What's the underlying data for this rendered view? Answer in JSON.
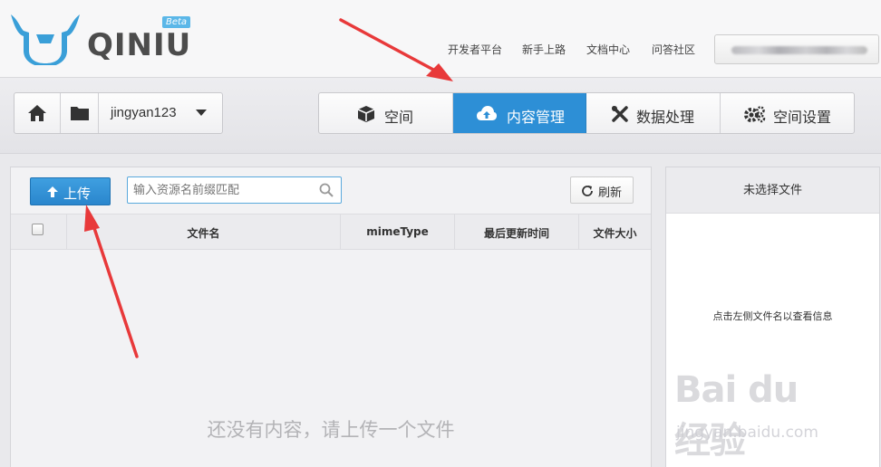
{
  "brand": {
    "name": "QINIU",
    "badge": "Beta"
  },
  "topnav": [
    "开发者平台",
    "新手上路",
    "文档中心",
    "问答社区"
  ],
  "bucket": {
    "name": "jingyan123"
  },
  "tabs": [
    {
      "label": "空间",
      "icon": "cube-icon"
    },
    {
      "label": "内容管理",
      "icon": "cloud-upload-icon",
      "active": true
    },
    {
      "label": "数据处理",
      "icon": "tools-icon"
    },
    {
      "label": "空间设置",
      "icon": "gears-icon"
    }
  ],
  "actions": {
    "upload_label": "上传",
    "search_placeholder": "输入资源名前缀匹配",
    "refresh_label": "刷新"
  },
  "table": {
    "columns": [
      "文件名",
      "mimeType",
      "最后更新时间",
      "文件大小"
    ],
    "empty_text": "还没有内容，请上传一个文件"
  },
  "side": {
    "title": "未选择文件",
    "hint": "点击左侧文件名以查看信息"
  },
  "watermark": {
    "main": "Bai du 经验",
    "url": "jingyan.baidu.com"
  },
  "colors": {
    "accent": "#2d8fd6",
    "annotation": "#e8393a"
  }
}
